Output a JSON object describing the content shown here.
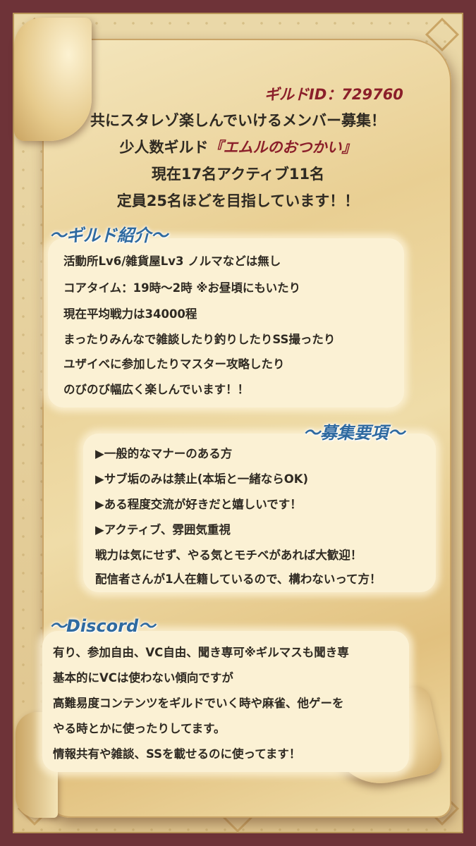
{
  "header": {
    "guild_id": "ギルドID：729760",
    "line1": "共にスタレゾ楽しんでいけるメンバー募集！",
    "line2_prefix": "少人数ギルド",
    "line2_name": "『エムルのおつかい』",
    "line3": "現在17名アクティブ11名",
    "line4": "定員25名ほどを目指しています！！"
  },
  "intro": {
    "heading": "～ギルド紹介～",
    "lines": [
      "活動所Lv6/雑貨屋Lv3 ノルマなどは無し",
      "コアタイム：19時～2時 ※お昼頃にもいたり",
      "現在平均戦力は34000程",
      "まったりみんなで雑談したり釣りしたりSS撮ったり",
      "ユザイベに参加したりマスター攻略したり",
      "のびのび幅広く楽しんでいます！！"
    ]
  },
  "recruit": {
    "heading": "～募集要項～",
    "lines": [
      "▶一般的なマナーのある方",
      "▶サブ垢のみは禁止(本垢と一緒ならOK)",
      "▶ある程度交流が好きだと嬉しいです！",
      "▶アクティブ、雰囲気重視",
      "戦力は気にせず、やる気とモチベがあれば大歓迎！",
      "配信者さんが1人在籍しているので、構わないって方！"
    ]
  },
  "discord": {
    "heading": "～Discord～",
    "lines": [
      "有り、参加自由、VC自由、聞き専可※ギルマスも聞き専",
      "基本的にVCは使わない傾向ですが",
      "高難易度コンテンツをギルドでいく時や麻雀、他ゲーを",
      "やる時とかに使ったりしてます。",
      "情報共有や雑談、SSを載せるのに使ってます！"
    ]
  }
}
